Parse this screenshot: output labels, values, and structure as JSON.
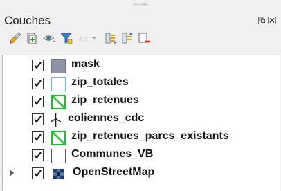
{
  "panel": {
    "title": "Couches"
  },
  "toolbar": {
    "buttons": [
      {
        "name": "layer-styling-icon"
      },
      {
        "name": "add-group-icon"
      },
      {
        "name": "manage-visibility-icon"
      },
      {
        "name": "filter-legend-icon"
      },
      {
        "name": "filter-by-expression-icon"
      },
      {
        "name": "expand-all-icon"
      },
      {
        "name": "collapse-all-icon"
      },
      {
        "name": "remove-layer-icon"
      }
    ]
  },
  "layers": [
    {
      "label": "mask",
      "checked": true,
      "symbol": "fill-slate",
      "symbol_color": "#8f93a6"
    },
    {
      "label": "zip_totales",
      "checked": true,
      "symbol": "fill-outline",
      "symbol_color": "#7fb0d8"
    },
    {
      "label": "zip_retenues",
      "checked": true,
      "symbol": "hatch-green",
      "symbol_color": "#17c22a"
    },
    {
      "label": "eoliennes_cdc",
      "checked": true,
      "symbol": "wind-turbine-icon",
      "symbol_color": "#222222"
    },
    {
      "label": "zip_retenues_parcs_existants",
      "checked": true,
      "symbol": "hatch-green",
      "symbol_color": "#17c22a"
    },
    {
      "label": "Communes_VB",
      "checked": true,
      "symbol": "fill-outline",
      "symbol_color": "#555555"
    },
    {
      "label": "OpenStreetMap",
      "checked": true,
      "symbol": "raster-tile-icon",
      "symbol_color": "#1e3a6e",
      "expandable": true
    }
  ]
}
